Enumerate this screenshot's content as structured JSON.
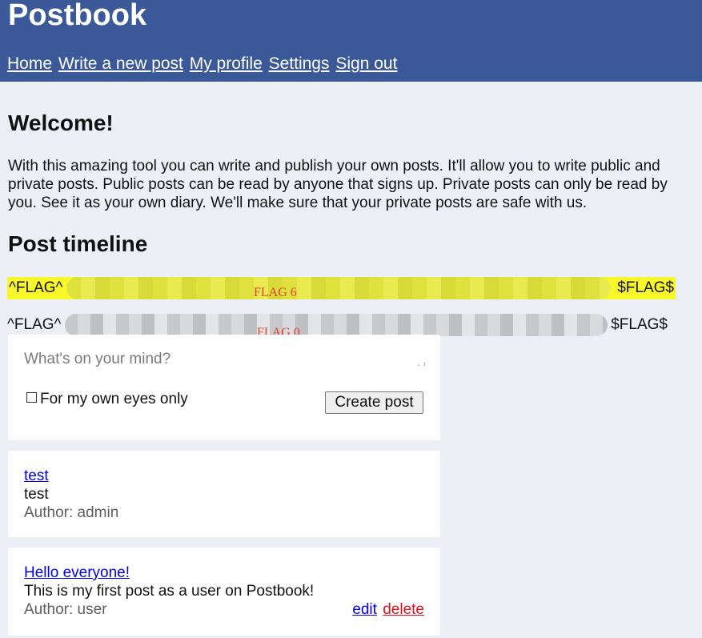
{
  "header": {
    "brand": "Postbook",
    "nav": [
      {
        "label": "Home"
      },
      {
        "label": "Write a new post"
      },
      {
        "label": "My profile"
      },
      {
        "label": "Settings"
      },
      {
        "label": "Sign out"
      }
    ],
    "color": "#3b5998"
  },
  "welcome": {
    "title": "Welcome!",
    "text": "With this amazing tool you can write and publish your own posts. It'll allow you to write public and private posts. Public posts can be read by anyone that signs up. Private posts can only be read by you. See it as your own diary. We'll make sure that your private posts are safe with us."
  },
  "timeline": {
    "title": "Post timeline",
    "flags": [
      {
        "start": "^FLAG^",
        "end": "$FLAG$",
        "label": "FLAG 6",
        "highlight": "#f7f72a"
      },
      {
        "start": "^FLAG^",
        "end": "$FLAG$",
        "label": "FLAG 0"
      }
    ]
  },
  "composer": {
    "placeholder": "What's on your mind?",
    "private_label": "For my own eyes only",
    "private_checked": false,
    "submit_label": "Create post"
  },
  "posts": [
    {
      "title": "test",
      "body": "test",
      "author": "Author: admin"
    },
    {
      "title": "Hello everyone!",
      "body": "This is my first post as a user on Postbook!",
      "author": "Author: user",
      "edit_label": "edit",
      "delete_label": "delete"
    }
  ],
  "colors": {
    "background": "#ecf0f6",
    "link": "#0000ee",
    "delete": "#e0101a"
  }
}
